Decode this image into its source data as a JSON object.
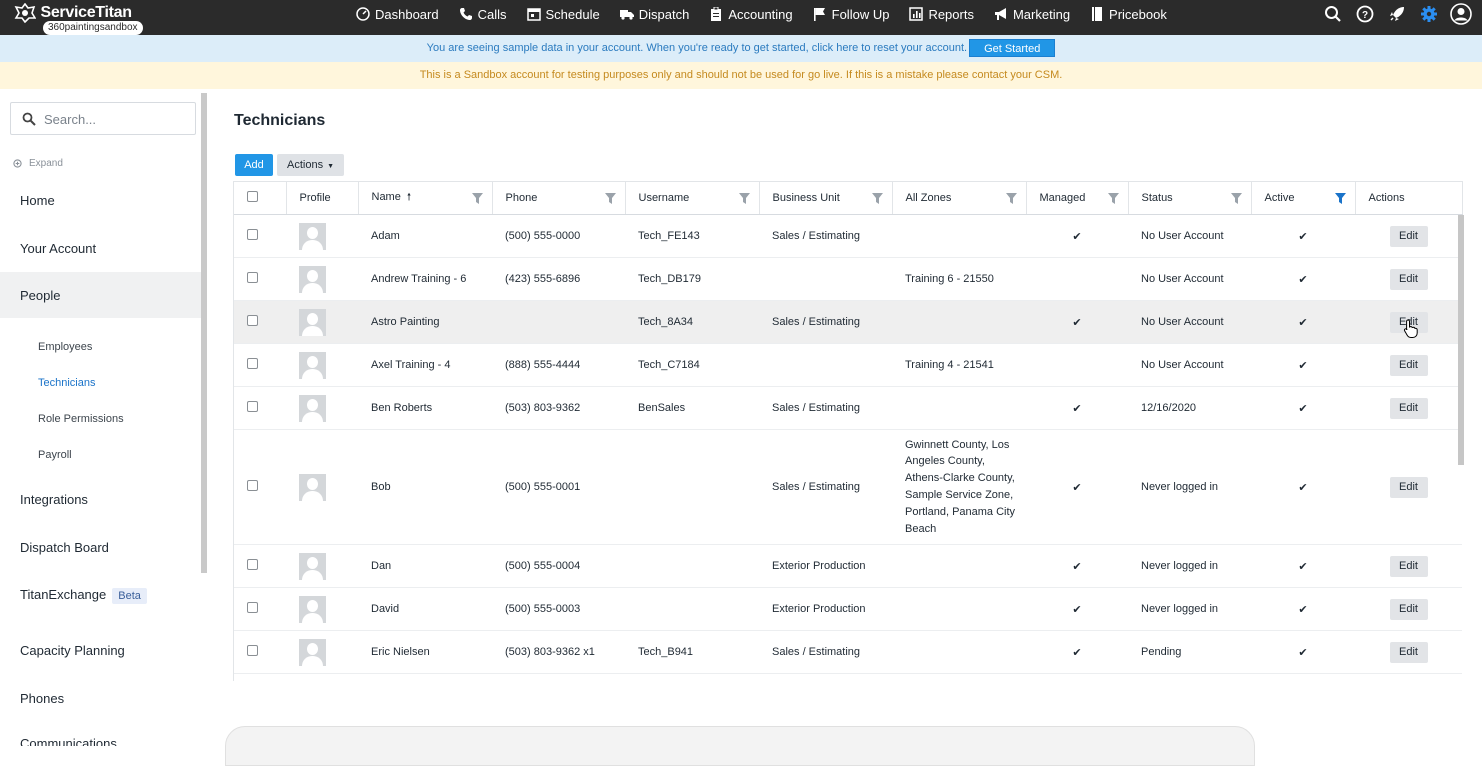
{
  "topnav": {
    "brand": "ServiceTitan",
    "account": "360paintingsandbox",
    "items": [
      {
        "label": "Dashboard",
        "icon": "dashboard-icon"
      },
      {
        "label": "Calls",
        "icon": "phone-icon"
      },
      {
        "label": "Schedule",
        "icon": "calendar-icon"
      },
      {
        "label": "Dispatch",
        "icon": "truck-icon"
      },
      {
        "label": "Accounting",
        "icon": "clipboard-icon"
      },
      {
        "label": "Follow Up",
        "icon": "flag-icon"
      },
      {
        "label": "Reports",
        "icon": "chart-icon"
      },
      {
        "label": "Marketing",
        "icon": "megaphone-icon"
      },
      {
        "label": "Pricebook",
        "icon": "book-icon"
      }
    ],
    "right_icons": [
      "search-icon",
      "help-icon",
      "rocket-icon",
      "gear-icon",
      "user-icon"
    ]
  },
  "banners": {
    "sample": "You are seeing sample data in your account. When you're ready to get started, click here to reset your account.",
    "get_started": "Get Started",
    "sandbox": "This is a Sandbox account for testing purposes only and should not be used for go live. If this is a mistake please contact your CSM."
  },
  "sidebar": {
    "search_placeholder": "Search...",
    "expand": "Expand",
    "items": {
      "home": "Home",
      "account": "Your Account",
      "people": "People",
      "integrations": "Integrations",
      "dispatch_board": "Dispatch Board",
      "titan_exchange": "TitanExchange",
      "beta": "Beta",
      "capacity": "Capacity Planning",
      "phones": "Phones",
      "communications": "Communications"
    },
    "sub": {
      "employees": "Employees",
      "technicians": "Technicians",
      "role_permissions": "Role Permissions",
      "payroll": "Payroll"
    }
  },
  "main": {
    "title": "Technicians",
    "add": "Add",
    "actions": "Actions",
    "columns": {
      "profile": "Profile",
      "name": "Name",
      "phone": "Phone",
      "username": "Username",
      "business_unit": "Business Unit",
      "zones": "All Zones",
      "managed": "Managed",
      "status": "Status",
      "active": "Active",
      "actions": "Actions"
    },
    "edit_label": "Edit",
    "check": "✔",
    "rows": [
      {
        "name": "Adam",
        "phone": "(500) 555-0000",
        "username": "Tech_FE143",
        "bu": "Sales / Estimating",
        "zones": "",
        "managed": true,
        "status": "No User Account",
        "active": true
      },
      {
        "name": "Andrew Training - 6",
        "phone": "(423) 555-6896",
        "username": "Tech_DB179",
        "bu": "",
        "zones": "Training 6 - 21550",
        "managed": false,
        "status": "No User Account",
        "active": true
      },
      {
        "name": "Astro Painting",
        "phone": "",
        "username": "Tech_8A34",
        "bu": "Sales / Estimating",
        "zones": "",
        "managed": true,
        "status": "No User Account",
        "active": true
      },
      {
        "name": "Axel Training - 4",
        "phone": "(888) 555-4444",
        "username": "Tech_C7184",
        "bu": "",
        "zones": "Training 4 - 21541",
        "managed": false,
        "status": "No User Account",
        "active": true
      },
      {
        "name": "Ben Roberts",
        "phone": "(503) 803-9362",
        "username": "BenSales",
        "bu": "Sales / Estimating",
        "zones": "",
        "managed": true,
        "status": "12/16/2020",
        "active": true
      },
      {
        "name": "Bob",
        "phone": "(500) 555-0001",
        "username": "",
        "bu": "Sales / Estimating",
        "zones": "Gwinnett County, Los Angeles County, Athens-Clarke County, Sample Service Zone, Portland, Panama City Beach",
        "managed": true,
        "status": "Never logged in",
        "active": true
      },
      {
        "name": "Dan",
        "phone": "(500) 555-0004",
        "username": "",
        "bu": "Exterior Production",
        "zones": "",
        "managed": true,
        "status": "Never logged in",
        "active": true
      },
      {
        "name": "David",
        "phone": "(500) 555-0003",
        "username": "",
        "bu": "Exterior Production",
        "zones": "",
        "managed": true,
        "status": "Never logged in",
        "active": true
      },
      {
        "name": "Eric Nielsen",
        "phone": "(503) 803-9362 x1",
        "username": "Tech_B941",
        "bu": "Sales / Estimating",
        "zones": "",
        "managed": true,
        "status": "Pending",
        "active": true
      }
    ]
  }
}
